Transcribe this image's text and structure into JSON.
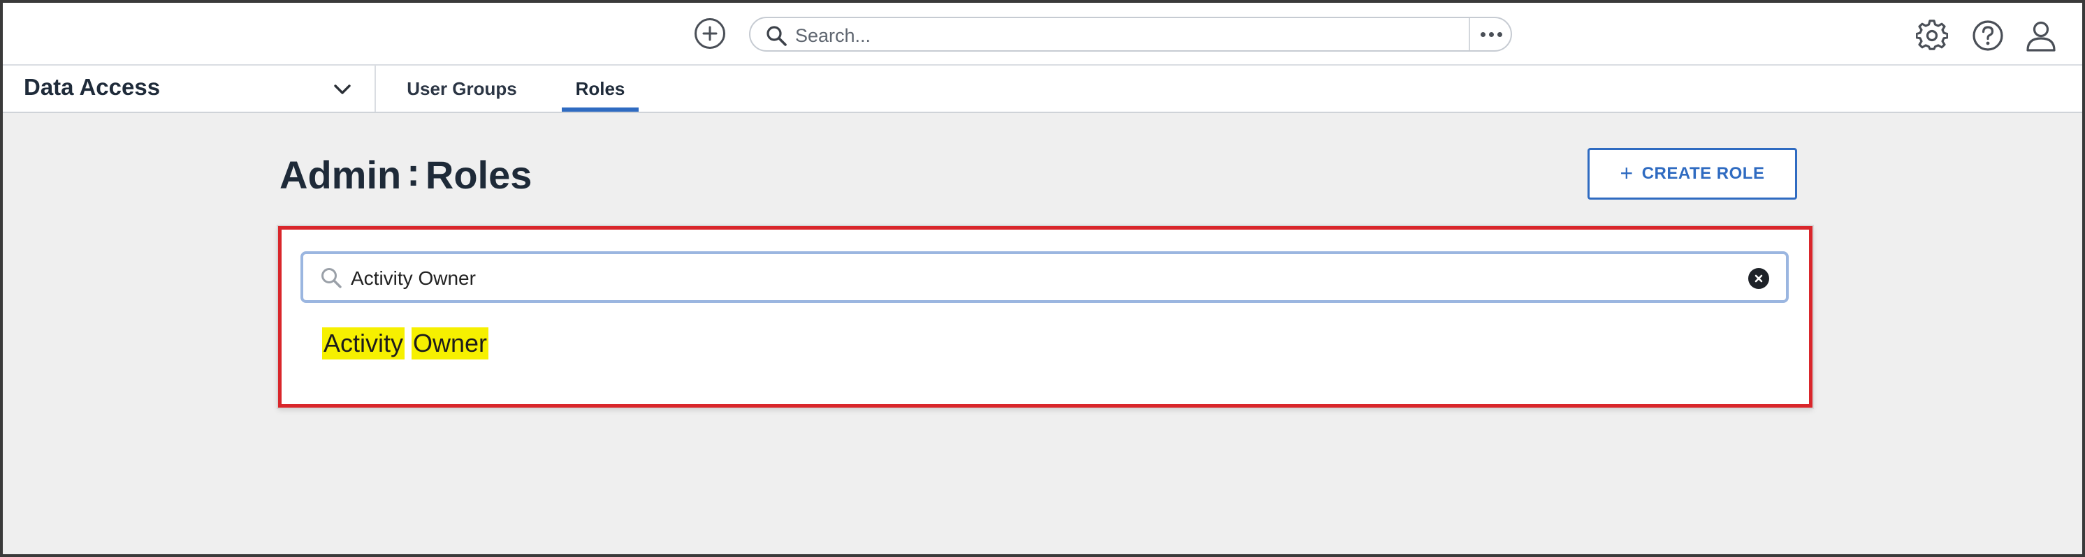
{
  "header": {
    "search_placeholder": "Search..."
  },
  "navbar": {
    "app_title": "Data Access",
    "tabs": [
      {
        "label": "User Groups",
        "active": false
      },
      {
        "label": "Roles",
        "active": true
      }
    ]
  },
  "page": {
    "title_prefix": "Admin",
    "title_separator": ":",
    "title_main": "Roles",
    "create_button_label": "CREATE ROLE"
  },
  "role_search": {
    "value": "Activity Owner",
    "results": [
      {
        "highlight_words": [
          "Activity",
          "Owner"
        ]
      }
    ]
  },
  "colors": {
    "accent": "#2f6bc1",
    "highlight": "#f6f000",
    "annotation_border": "#d9262b"
  },
  "icons": {
    "add": "plus-circle-icon",
    "search": "search-icon",
    "more": "more-horizontal-icon",
    "settings": "gear-icon",
    "help": "help-icon",
    "user": "user-icon",
    "chevron": "chevron-down-icon",
    "clear": "clear-icon"
  }
}
